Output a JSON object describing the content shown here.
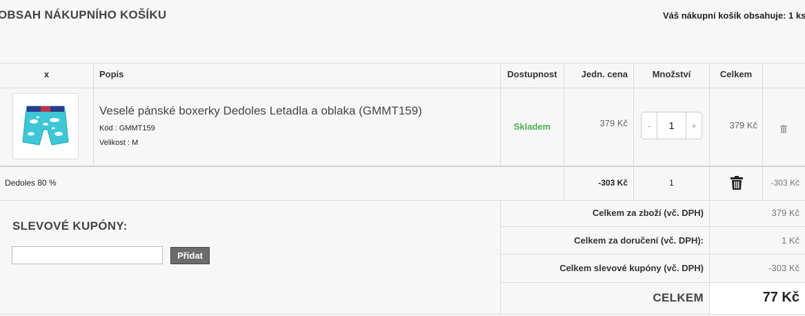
{
  "page": {
    "title": "OBSAH NÁKUPNÍHO KOŠÍKU",
    "cart_count": "Váš nákupní košík obsahuje: 1 ks"
  },
  "table": {
    "headers": {
      "x": "x",
      "description": "Popis",
      "availability": "Dostupnost",
      "unit_price": "Jedn. cena",
      "quantity": "Množství",
      "total": "Celkem"
    },
    "item": {
      "name": "Veselé pánské boxerky Dedoles Letadla a oblaka (GMMT159)",
      "code": "Kód : GMMT159",
      "size": "Velikost : M",
      "availability": "Skladem",
      "unit_price": "379 Kč",
      "quantity": "1",
      "qty_minus": "-",
      "qty_plus": "+",
      "total": "379 Kč",
      "image_icon": "boxer-shorts-image",
      "remove_icon": "trash-icon"
    },
    "discount": {
      "name": "Dedoles 80 %",
      "unit_price": "-303 Kč",
      "quantity": "1",
      "total": "-303 Kč",
      "remove_icon": "trash-icon"
    }
  },
  "coupon": {
    "title": "SLEVOVÉ KUPÓNY:",
    "input_value": "",
    "button": "Přidat"
  },
  "summary": {
    "goods_label": "Celkem za zboží (vč. DPH)",
    "goods_value": "379 Kč",
    "delivery_label": "Celkem za doručení (vč. DPH):",
    "delivery_value": "1 Kč",
    "coupons_label": "Celkem slevové kupóny (vč. DPH)",
    "coupons_value": "-303 Kč",
    "total_label": "CELKEM",
    "total_value": "77 Kč"
  },
  "colors": {
    "in_stock": "#4cb050",
    "coupon_button": "#6c6c6c",
    "background": "#f7f7f7"
  }
}
